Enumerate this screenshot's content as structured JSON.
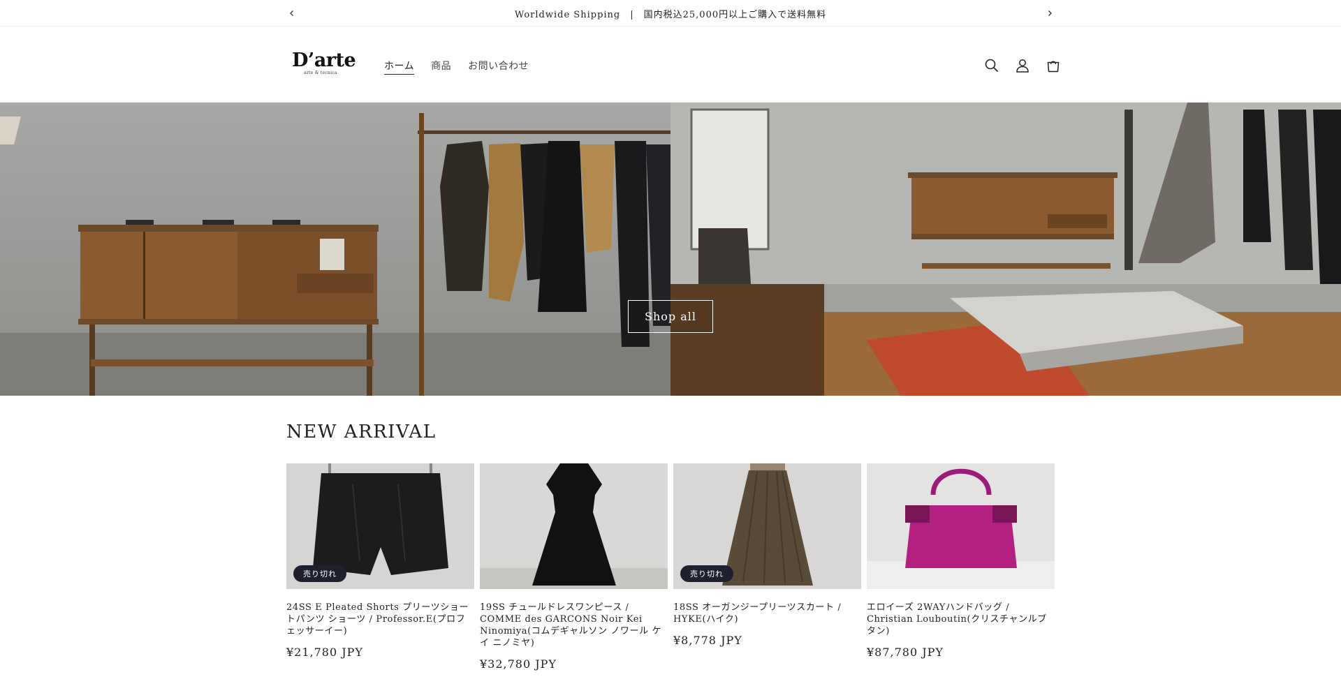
{
  "announcement": {
    "message": "Worldwide Shipping　|　国内税込25,000円以上ご購入で送料無料",
    "prev_icon": "chevron-left-icon",
    "next_icon": "chevron-right-icon"
  },
  "header": {
    "logo_word": "D’arte",
    "logo_tagline": "arte & tecnica",
    "nav": [
      {
        "label": "ホーム",
        "active": true
      },
      {
        "label": "商品",
        "active": false
      },
      {
        "label": "お問い合わせ",
        "active": false
      }
    ],
    "icons": [
      "search-icon",
      "account-icon",
      "cart-icon"
    ]
  },
  "hero": {
    "button_label": "Shop all"
  },
  "section": {
    "title": "NEW ARRIVAL"
  },
  "products": [
    {
      "title": "24SS E Pleated Shorts プリーツショートパンツ ショーツ / Professor.E(プロフェッサーイー)",
      "price": "¥21,780 JPY",
      "badge": "売り切れ"
    },
    {
      "title": "19SS チュールドレスワンピース / COMME des GARCONS Noir Kei Ninomiya(コムデギャルソン ノワール ケイ ニノミヤ)",
      "price": "¥32,780 JPY",
      "badge": ""
    },
    {
      "title": "18SS オーガンジープリーツスカート / HYKE(ハイク)",
      "price": "¥8,778 JPY",
      "badge": "売り切れ"
    },
    {
      "title": "エロイーズ 2WAYハンドバッグ / Christian Louboutin(クリスチャンルブタン)",
      "price": "¥87,780 JPY",
      "badge": ""
    }
  ]
}
